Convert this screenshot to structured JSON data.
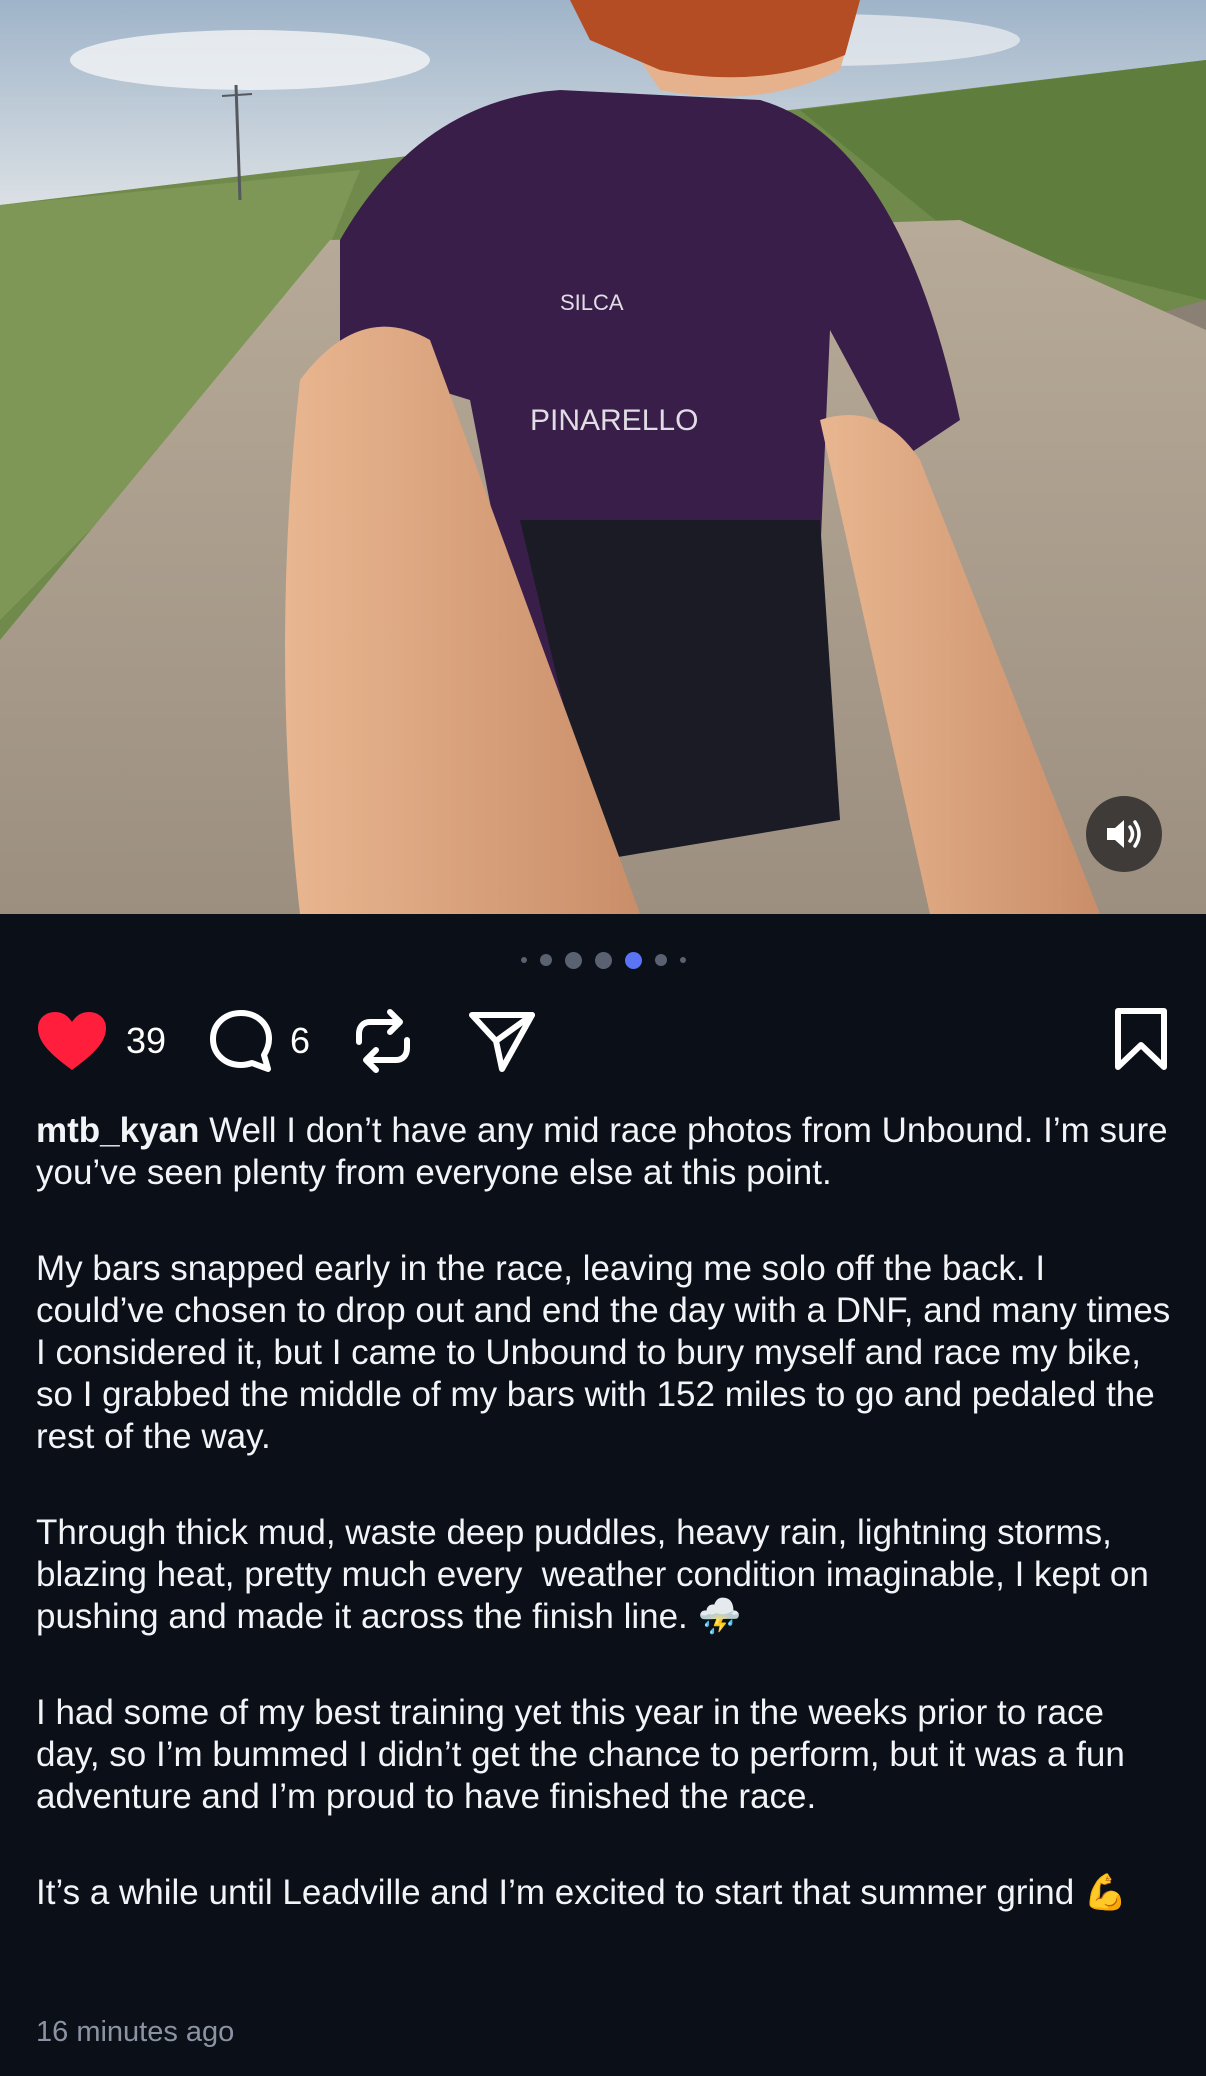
{
  "post": {
    "username": "mtb_kyan",
    "caption_first": " Well I don’t have any mid race photos from Unbound. I’m sure you’ve seen plenty from everyone else at this point.",
    "caption_paragraphs": [
      "My bars snapped early in the race, leaving me solo off the back. I could’ve chosen to drop out and end the day with a DNF, and many times I considered it, but I came to Unbound to bury myself and race my bike, so I grabbed the middle of my bars with 152 miles to go and pedaled the rest of the way.",
      "Through thick mud, waste deep puddles, heavy rain, lightning storms, blazing heat, pretty much every  weather condition imaginable, I kept on pushing and made it across the finish line. ⛈️",
      "I had some of my best training yet this year in the weeks prior to race day, so I’m bummed I didn’t get the chance to perform, but it was a fun adventure and I’m proud to have finished the race.",
      "It’s a while until Leadville and I’m excited to start that summer grind 💪"
    ],
    "timestamp": "16 minutes ago"
  },
  "actions": {
    "likes": "39",
    "comments": "6"
  },
  "icons": {
    "like": "heart-filled-icon",
    "comment": "speech-bubble-icon",
    "repost": "repost-arrows-icon",
    "share": "paper-plane-icon",
    "save": "bookmark-icon",
    "sound": "speaker-icon"
  },
  "colors": {
    "background": "#0b0f17",
    "like": "#ff1f3d",
    "active_dot": "#5b74f5",
    "timestamp": "#8b93a3"
  },
  "carousel": {
    "slide_count": 7,
    "active_index": 4
  }
}
